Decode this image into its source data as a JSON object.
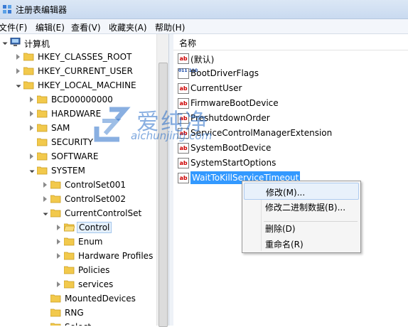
{
  "window": {
    "title": "注册表编辑器"
  },
  "menu": [
    "文件(F)",
    "编辑(E)",
    "查看(V)",
    "收藏夹(A)",
    "帮助(H)"
  ],
  "tree": [
    {
      "label": "计算机",
      "level": 0,
      "expander": "open",
      "kind": "computer"
    },
    {
      "label": "HKEY_CLASSES_ROOT",
      "level": 1,
      "expander": "closed"
    },
    {
      "label": "HKEY_CURRENT_USER",
      "level": 1,
      "expander": "closed"
    },
    {
      "label": "HKEY_LOCAL_MACHINE",
      "level": 1,
      "expander": "open"
    },
    {
      "label": "BCD00000000",
      "level": 2,
      "expander": "closed"
    },
    {
      "label": "HARDWARE",
      "level": 2,
      "expander": "closed"
    },
    {
      "label": "SAM",
      "level": 2,
      "expander": "closed"
    },
    {
      "label": "SECURITY",
      "level": 2,
      "expander": "none"
    },
    {
      "label": "SOFTWARE",
      "level": 2,
      "expander": "closed"
    },
    {
      "label": "SYSTEM",
      "level": 2,
      "expander": "open"
    },
    {
      "label": "ControlSet001",
      "level": 3,
      "expander": "closed"
    },
    {
      "label": "ControlSet002",
      "level": 3,
      "expander": "closed"
    },
    {
      "label": "CurrentControlSet",
      "level": 3,
      "expander": "open"
    },
    {
      "label": "Control",
      "level": 4,
      "expander": "closed",
      "selected": true,
      "open_folder": true
    },
    {
      "label": "Enum",
      "level": 4,
      "expander": "closed"
    },
    {
      "label": "Hardware Profiles",
      "level": 4,
      "expander": "closed"
    },
    {
      "label": "Policies",
      "level": 4,
      "expander": "none"
    },
    {
      "label": "services",
      "level": 4,
      "expander": "closed"
    },
    {
      "label": "MountedDevices",
      "level": 3,
      "expander": "none"
    },
    {
      "label": "RNG",
      "level": 3,
      "expander": "none"
    },
    {
      "label": "Select",
      "level": 3,
      "expander": "none"
    }
  ],
  "list": {
    "column_name": "名称",
    "values": [
      {
        "name": "(默认)",
        "type": "string"
      },
      {
        "name": "BootDriverFlags",
        "type": "binary"
      },
      {
        "name": "CurrentUser",
        "type": "string"
      },
      {
        "name": "FirmwareBootDevice",
        "type": "string"
      },
      {
        "name": "PreshutdownOrder",
        "type": "string"
      },
      {
        "name": "ServiceControlManagerExtension",
        "type": "string"
      },
      {
        "name": "SystemBootDevice",
        "type": "string"
      },
      {
        "name": "SystemStartOptions",
        "type": "string"
      },
      {
        "name": "WaitToKillServiceTimeout",
        "type": "string",
        "selected": true
      }
    ],
    "string_icon_glyph": "ab",
    "binary_icon_glyph": "011 110"
  },
  "context_menu": {
    "modify": "修改(M)...",
    "modify_binary": "修改二进制数据(B)...",
    "delete": "删除(D)",
    "rename": "重命名(R)"
  },
  "watermark": {
    "brand": "爱纯净",
    "site": "aichunjing.com"
  },
  "colors": {
    "folder": "#f2c94c",
    "selection": "#3399ff",
    "accent": "#2a6ec8"
  }
}
